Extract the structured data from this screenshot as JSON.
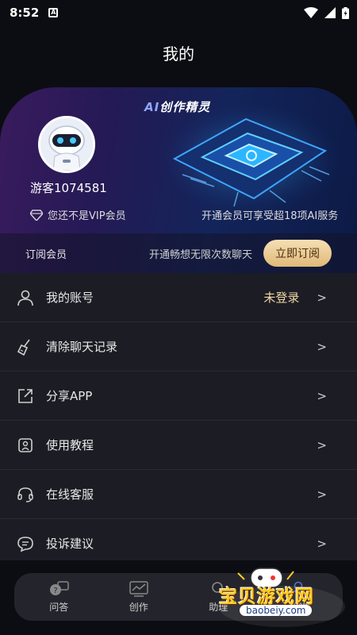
{
  "status_bar": {
    "time": "8:52",
    "notification_icon": "a-icon"
  },
  "header": {
    "title": "我的"
  },
  "vip_card": {
    "banner_title_ai": "AI",
    "banner_title_rest": "创作精灵",
    "username": "游客1074581",
    "vip_status": "您还不是VIP会员",
    "promo": "开通会员可享受超18项AI服务",
    "subscribe": {
      "label": "订阅会员",
      "description": "开通畅想无限次数聊天",
      "button": "立即订阅"
    }
  },
  "menu": [
    {
      "label": "我的账号",
      "value": "未登录",
      "icon": "user-icon"
    },
    {
      "label": "清除聊天记录",
      "icon": "broom-icon"
    },
    {
      "label": "分享APP",
      "icon": "share-icon"
    },
    {
      "label": "使用教程",
      "icon": "tutorial-icon"
    },
    {
      "label": "在线客服",
      "icon": "headset-icon"
    },
    {
      "label": "投诉建议",
      "icon": "chat-bubble-icon"
    }
  ],
  "chevron": ">",
  "tabs": [
    {
      "label": "问答",
      "icon": "qa-icon"
    },
    {
      "label": "创作",
      "icon": "chart-icon"
    },
    {
      "label": "助理",
      "icon": "assistant-icon"
    },
    {
      "label": "我的",
      "icon": "profile-icon"
    }
  ],
  "watermark": {
    "text": "宝贝游戏网",
    "url": "baobeiy.com"
  },
  "colors": {
    "accent_gold": "#f1d7a6",
    "background": "#0c0d12",
    "list_bg": "#1c1d24"
  }
}
